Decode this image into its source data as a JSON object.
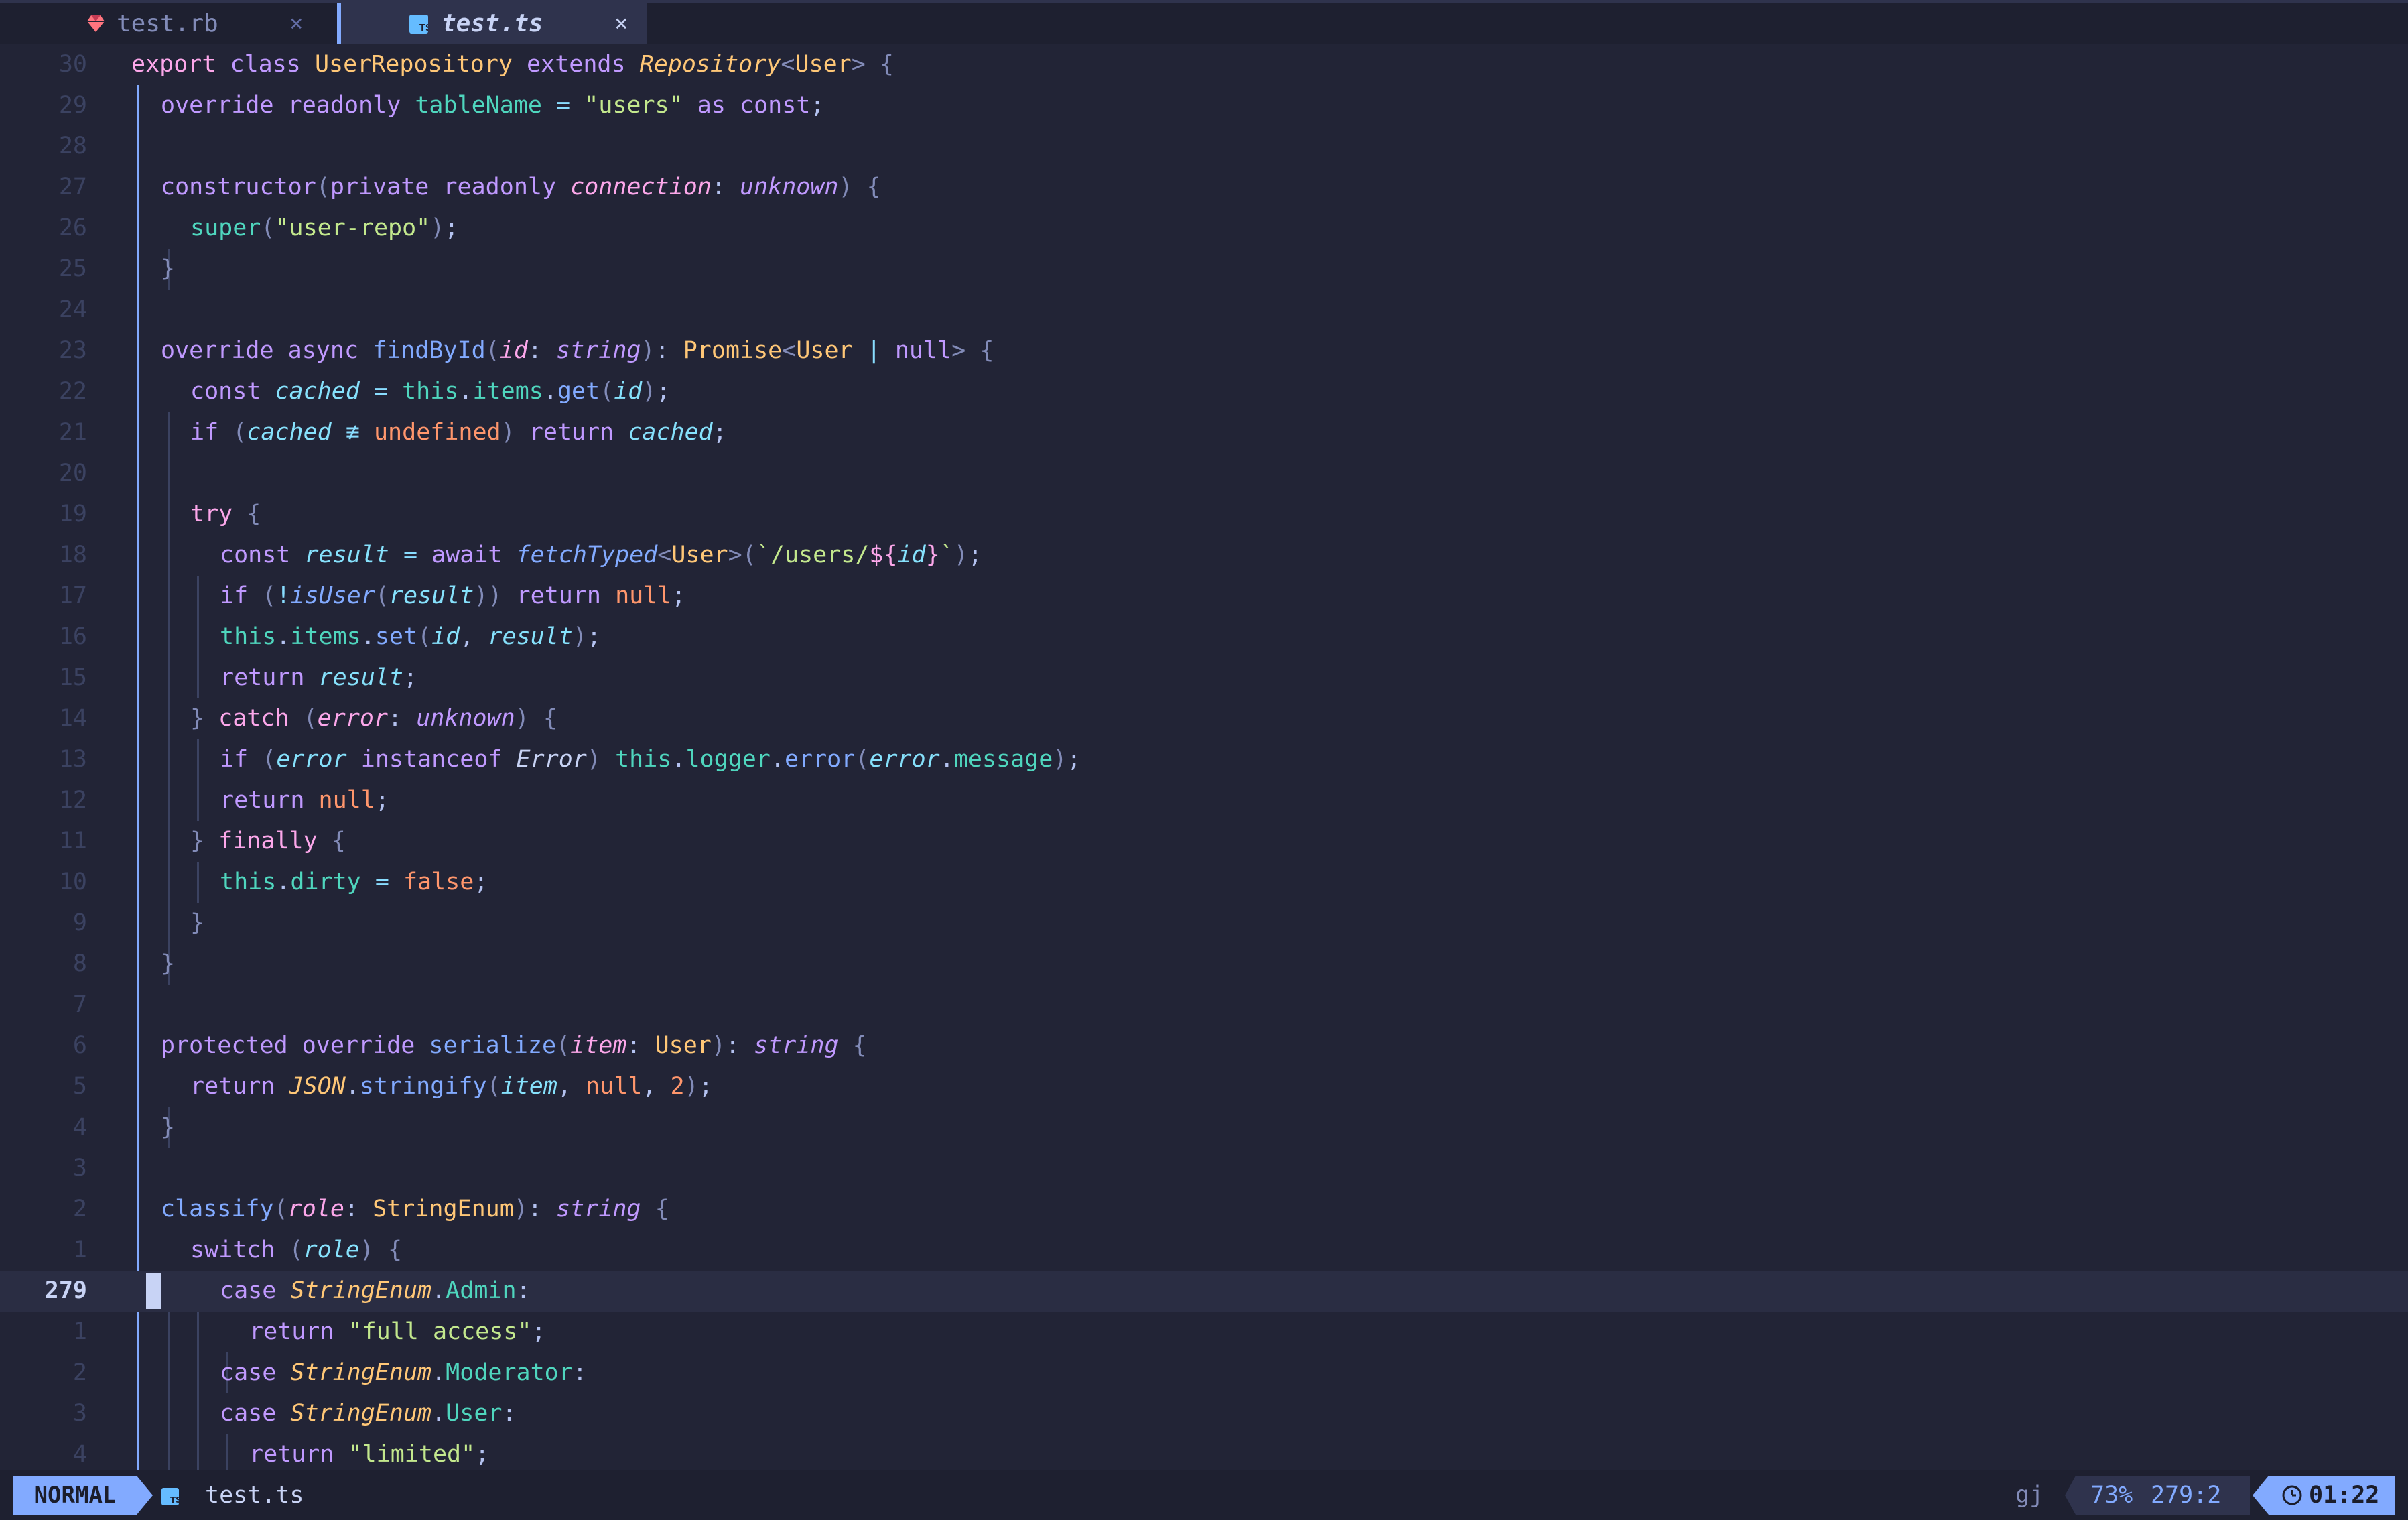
{
  "tabs": [
    {
      "label": "test.rb",
      "icon": "ruby-icon",
      "active": false
    },
    {
      "label": "test.ts",
      "icon": "typescript-icon",
      "active": true
    }
  ],
  "tab_close_glyph": "×",
  "colors": {
    "background": "#222436",
    "accent": "#82aaff",
    "ruby": "#ff757f",
    "typescript": "#65bcff"
  },
  "editor": {
    "current_line": 279,
    "line_numbers": [
      "30",
      "29",
      "28",
      "27",
      "26",
      "25",
      "24",
      "23",
      "22",
      "21",
      "20",
      "19",
      "18",
      "17",
      "16",
      "15",
      "14",
      "13",
      "12",
      "11",
      "10",
      "9",
      "8",
      "7",
      "6",
      "5",
      "4",
      "3",
      "2",
      "1",
      "279",
      "1",
      "2",
      "3",
      "4"
    ]
  },
  "status": {
    "mode": "NORMAL",
    "filename": "test.ts",
    "file_icon": "typescript-icon",
    "pending_keys": "gj",
    "percent": "73%",
    "position": "279:2",
    "clock_icon": "clock-icon",
    "time": "01:22"
  }
}
